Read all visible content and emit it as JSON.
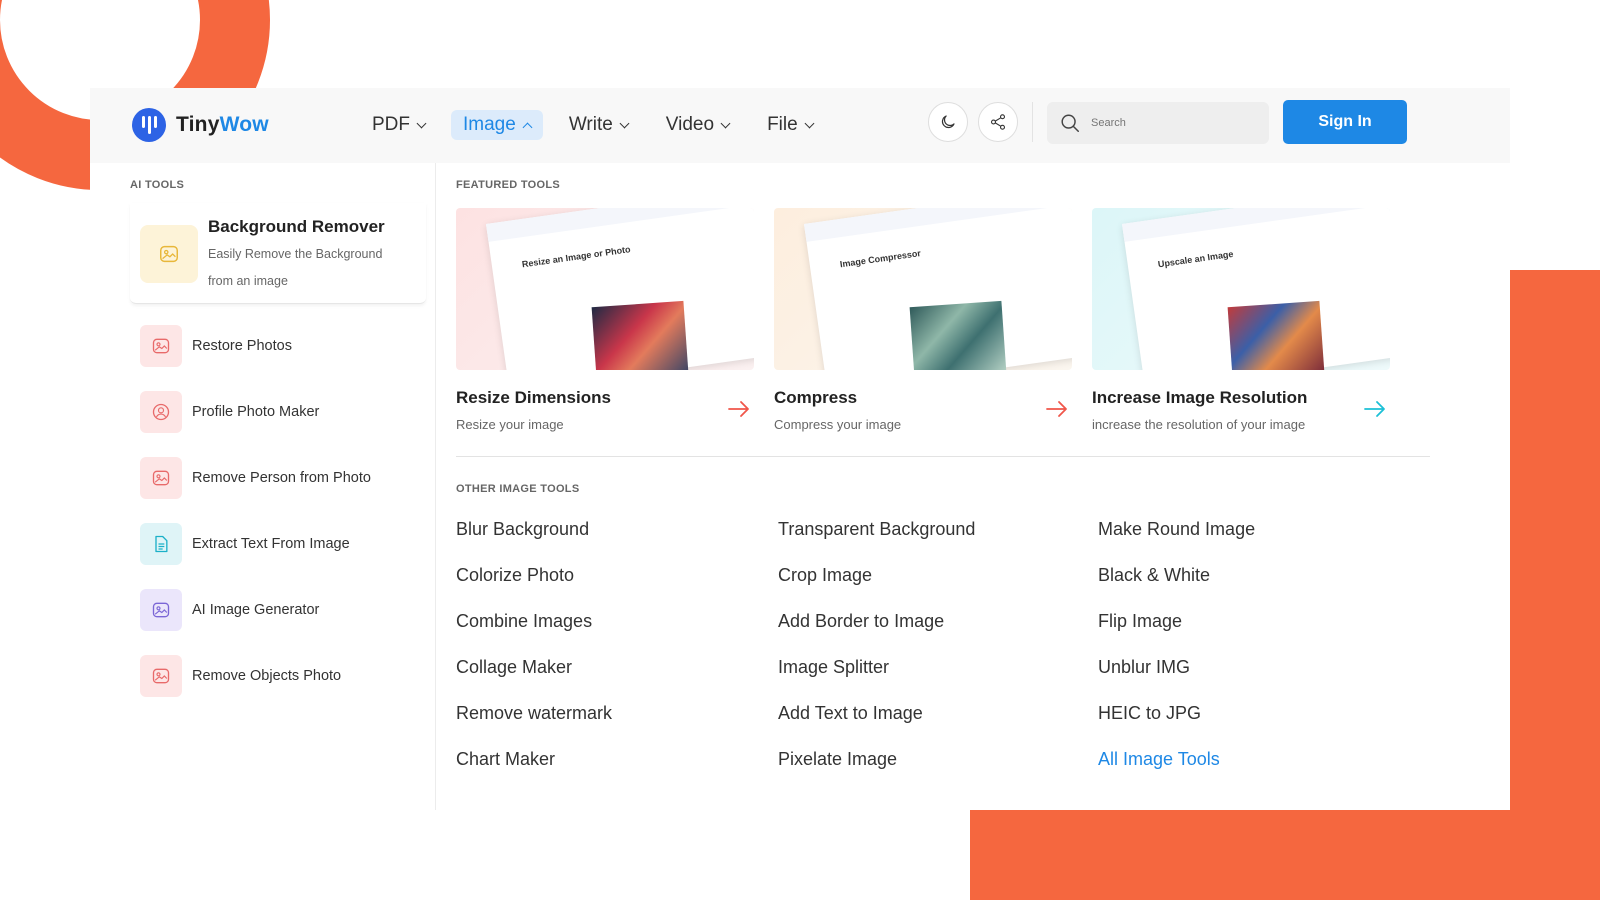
{
  "colors": {
    "accent": "#1e88e5",
    "brand_orange": "#f5673f"
  },
  "header": {
    "logo_part1": "Tiny",
    "logo_part2": "Wow",
    "nav": [
      {
        "label": "PDF",
        "active": false
      },
      {
        "label": "Image",
        "active": true
      },
      {
        "label": "Write",
        "active": false
      },
      {
        "label": "Video",
        "active": false
      },
      {
        "label": "File",
        "active": false
      }
    ],
    "search_placeholder": "Search",
    "sign_in": "Sign In",
    "icons": [
      "moon-icon",
      "share-icon",
      "search-icon"
    ]
  },
  "ai_tools": {
    "title": "AI TOOLS",
    "featured": {
      "title": "Background Remover",
      "desc": "Easily Remove the Background from an image",
      "icon": "image-icon"
    },
    "items": [
      {
        "label": "Restore Photos",
        "icon": "image-icon"
      },
      {
        "label": "Profile Photo Maker",
        "icon": "profile-icon"
      },
      {
        "label": "Remove Person from Photo",
        "icon": "image-icon"
      },
      {
        "label": "Extract Text From Image",
        "icon": "document-icon"
      },
      {
        "label": "AI Image Generator",
        "icon": "image-icon"
      },
      {
        "label": "Remove Objects Photo",
        "icon": "image-icon"
      }
    ]
  },
  "featured_tools": {
    "title": "FEATURED TOOLS",
    "items": [
      {
        "title": "Resize Dimensions",
        "desc": "Resize your image",
        "thumb_text": "Resize an Image or Photo",
        "arrow_color": "#f0564a"
      },
      {
        "title": "Compress",
        "desc": "Compress your image",
        "thumb_text": "Image Compressor",
        "arrow_color": "#f0564a"
      },
      {
        "title": "Increase Image Resolution",
        "desc": "increase the resolution of your image",
        "thumb_text": "Upscale an Image",
        "arrow_color": "#1cc0d6"
      }
    ]
  },
  "other_tools": {
    "title": "OTHER IMAGE TOOLS",
    "columns": [
      [
        "Blur Background",
        "Colorize Photo",
        "Combine Images",
        "Collage Maker",
        "Remove watermark",
        "Chart Maker"
      ],
      [
        "Transparent Background",
        "Crop Image",
        "Add Border to Image",
        "Image Splitter",
        "Add Text to Image",
        "Pixelate Image"
      ],
      [
        "Make Round Image",
        "Black & White",
        "Flip Image",
        "Unblur IMG",
        "HEIC to JPG",
        "All Image Tools"
      ]
    ]
  }
}
